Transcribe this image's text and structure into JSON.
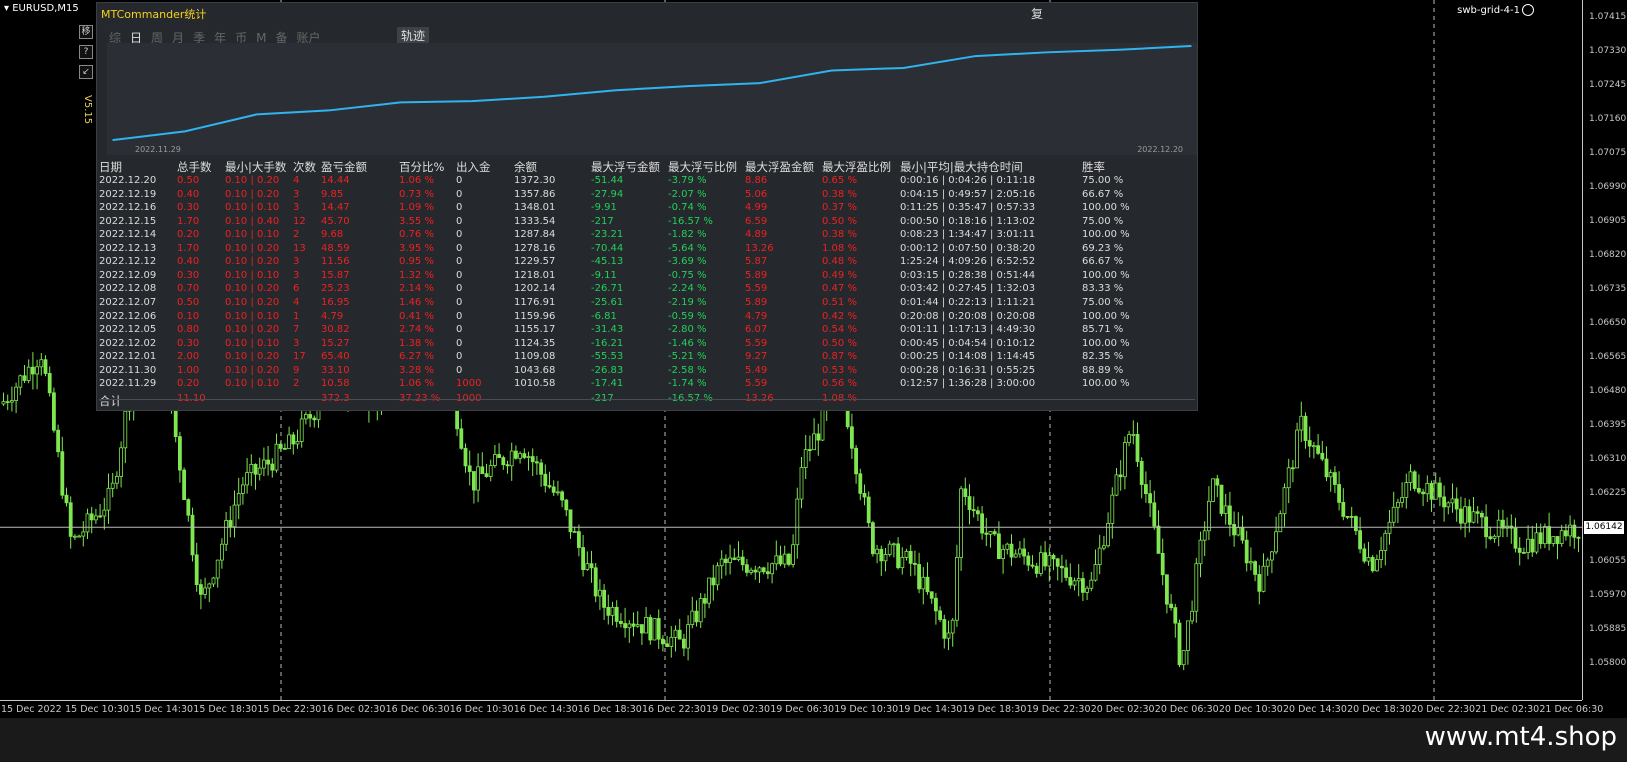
{
  "chart": {
    "symbol": "EURUSD,M15",
    "ea_name": "swb-grid-4-1",
    "current_price": "1.06142",
    "price_ticks": [
      "1.07415",
      "1.07330",
      "1.07245",
      "1.07160",
      "1.07075",
      "1.06990",
      "1.06905",
      "1.06820",
      "1.06735",
      "1.06650",
      "1.06565",
      "1.06480",
      "1.06395",
      "1.06310",
      "1.06225",
      "1.06055",
      "1.05970",
      "1.05885",
      "1.05800"
    ],
    "time_ticks": [
      "15 Dec 2022",
      "15 Dec 10:30",
      "15 Dec 14:30",
      "15 Dec 18:30",
      "15 Dec 22:30",
      "16 Dec 02:30",
      "16 Dec 06:30",
      "16 Dec 10:30",
      "16 Dec 14:30",
      "16 Dec 18:30",
      "16 Dec 22:30",
      "19 Dec 02:30",
      "19 Dec 06:30",
      "19 Dec 10:30",
      "19 Dec 14:30",
      "19 Dec 18:30",
      "19 Dec 22:30",
      "20 Dec 02:30",
      "20 Dec 06:30",
      "20 Dec 10:30",
      "20 Dec 14:30",
      "20 Dec 18:30",
      "20 Dec 22:30",
      "21 Dec 02:30",
      "21 Dec 06:30"
    ],
    "candle_color": "#7fe650",
    "background": "#000000"
  },
  "side_buttons": [
    "移",
    "?",
    "↙"
  ],
  "version": "V5.15",
  "panel": {
    "title": "MTCommander统计",
    "restore_label": "复",
    "tabs": [
      "综",
      "日",
      "周",
      "月",
      "季",
      "年",
      "币",
      "M",
      "备",
      "账户"
    ],
    "active_tab": "日",
    "trace_tab": "轨迹",
    "equity_start": "2022.11.29",
    "equity_end": "2022.12.20",
    "equity_curve": [
      1010.58,
      1043.68,
      1109.08,
      1124.35,
      1155.17,
      1159.96,
      1176.91,
      1202.14,
      1218.01,
      1229.57,
      1278.16,
      1287.84,
      1333.54,
      1348.01,
      1357.86,
      1372.3
    ],
    "headers": [
      "日期",
      "总手数",
      "最小|大手数",
      "次数",
      "盈亏金额",
      "百分比%",
      "出入金",
      "余额",
      "最大浮亏金额",
      "最大浮亏比例",
      "最大浮盈金额",
      "最大浮盈比例",
      "最小|平均|最大持仓时间",
      "胜率"
    ],
    "rows": [
      [
        "2022.12.20",
        "0.50",
        "0.10 | 0.20",
        "4",
        "14.44",
        "1.06 %",
        "0",
        "1372.30",
        "-51.44",
        "-3.79 %",
        "8.86",
        "0.65 %",
        "0:00:16 | 0:04:26 | 0:11:18",
        "75.00 %"
      ],
      [
        "2022.12.19",
        "0.40",
        "0.10 | 0.20",
        "3",
        "9.85",
        "0.73 %",
        "0",
        "1357.86",
        "-27.94",
        "-2.07 %",
        "5.06",
        "0.38 %",
        "0:04:15 | 0:49:57 | 2:05:16",
        "66.67 %"
      ],
      [
        "2022.12.16",
        "0.30",
        "0.10 | 0.10",
        "3",
        "14.47",
        "1.09 %",
        "0",
        "1348.01",
        "-9.91",
        "-0.74 %",
        "4.99",
        "0.37 %",
        "0:11:25 | 0:35:47 | 0:57:33",
        "100.00 %"
      ],
      [
        "2022.12.15",
        "1.70",
        "0.10 | 0.40",
        "12",
        "45.70",
        "3.55 %",
        "0",
        "1333.54",
        "-217",
        "-16.57 %",
        "6.59",
        "0.50 %",
        "0:00:50 | 0:18:16 | 1:13:02",
        "75.00 %"
      ],
      [
        "2022.12.14",
        "0.20",
        "0.10 | 0.10",
        "2",
        "9.68",
        "0.76 %",
        "0",
        "1287.84",
        "-23.21",
        "-1.82 %",
        "4.89",
        "0.38 %",
        "0:08:23 | 1:34:47 | 3:01:11",
        "100.00 %"
      ],
      [
        "2022.12.13",
        "1.70",
        "0.10 | 0.20",
        "13",
        "48.59",
        "3.95 %",
        "0",
        "1278.16",
        "-70.44",
        "-5.64 %",
        "13.26",
        "1.08 %",
        "0:00:12 | 0:07:50 | 0:38:20",
        "69.23 %"
      ],
      [
        "2022.12.12",
        "0.40",
        "0.10 | 0.20",
        "3",
        "11.56",
        "0.95 %",
        "0",
        "1229.57",
        "-45.13",
        "-3.69 %",
        "5.87",
        "0.48 %",
        "1:25:24 | 4:09:26 | 6:52:52",
        "66.67 %"
      ],
      [
        "2022.12.09",
        "0.30",
        "0.10 | 0.10",
        "3",
        "15.87",
        "1.32 %",
        "0",
        "1218.01",
        "-9.11",
        "-0.75 %",
        "5.89",
        "0.49 %",
        "0:03:15 | 0:28:38 | 0:51:44",
        "100.00 %"
      ],
      [
        "2022.12.08",
        "0.70",
        "0.10 | 0.20",
        "6",
        "25.23",
        "2.14 %",
        "0",
        "1202.14",
        "-26.71",
        "-2.24 %",
        "5.59",
        "0.47 %",
        "0:03:42 | 0:27:45 | 1:32:03",
        "83.33 %"
      ],
      [
        "2022.12.07",
        "0.50",
        "0.10 | 0.20",
        "4",
        "16.95",
        "1.46 %",
        "0",
        "1176.91",
        "-25.61",
        "-2.19 %",
        "5.89",
        "0.51 %",
        "0:01:44 | 0:22:13 | 1:11:21",
        "75.00 %"
      ],
      [
        "2022.12.06",
        "0.10",
        "0.10 | 0.10",
        "1",
        "4.79",
        "0.41 %",
        "0",
        "1159.96",
        "-6.81",
        "-0.59 %",
        "4.79",
        "0.42 %",
        "0:20:08 | 0:20:08 | 0:20:08",
        "100.00 %"
      ],
      [
        "2022.12.05",
        "0.80",
        "0.10 | 0.20",
        "7",
        "30.82",
        "2.74 %",
        "0",
        "1155.17",
        "-31.43",
        "-2.80 %",
        "6.07",
        "0.54 %",
        "0:01:11 | 1:17:13 | 4:49:30",
        "85.71 %"
      ],
      [
        "2022.12.02",
        "0.30",
        "0.10 | 0.10",
        "3",
        "15.27",
        "1.38 %",
        "0",
        "1124.35",
        "-16.21",
        "-1.46 %",
        "5.59",
        "0.50 %",
        "0:00:45 | 0:04:54 | 0:10:12",
        "100.00 %"
      ],
      [
        "2022.12.01",
        "2.00",
        "0.10 | 0.20",
        "17",
        "65.40",
        "6.27 %",
        "0",
        "1109.08",
        "-55.53",
        "-5.21 %",
        "9.27",
        "0.87 %",
        "0:00:25 | 0:14:08 | 1:14:45",
        "82.35 %"
      ],
      [
        "2022.11.30",
        "1.00",
        "0.10 | 0.20",
        "9",
        "33.10",
        "3.28 %",
        "0",
        "1043.68",
        "-26.83",
        "-2.58 %",
        "5.49",
        "0.53 %",
        "0:00:28 | 0:16:31 | 0:55:25",
        "88.89 %"
      ],
      [
        "2022.11.29",
        "0.20",
        "0.10 | 0.10",
        "2",
        "10.58",
        "1.06 %",
        "1000",
        "1010.58",
        "-17.41",
        "-1.74 %",
        "5.59",
        "0.56 %",
        "0:12:57 | 1:36:28 | 3:00:00",
        "100.00 %"
      ]
    ],
    "total": [
      "合计",
      "11.10",
      "",
      "",
      "372.3",
      "37.23 %",
      "1000",
      "",
      "-217",
      "-16.57 %",
      "13.26",
      "1.08 %",
      "",
      ""
    ]
  },
  "watermark": "www.mt4.shop"
}
